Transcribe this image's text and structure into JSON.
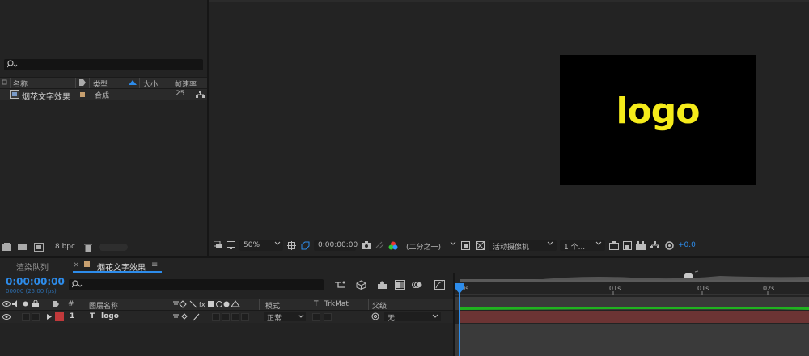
{
  "project_panel": {
    "columns": [
      "名称",
      "类型",
      "大小",
      "帧速率"
    ],
    "items": [
      {
        "name": "烟花文字效果",
        "type": "合成",
        "framerate": "25"
      }
    ],
    "bit_depth": "8 bpc"
  },
  "viewer": {
    "logo_text": "logo",
    "zoom": "50%",
    "timecode": "0:00:00:00",
    "resolution": "(二分之一)",
    "camera": "活动摄像机",
    "views": "1 个...",
    "exposure": "+0.0"
  },
  "timeline": {
    "tabs": [
      {
        "label": "渲染队列",
        "active": false
      },
      {
        "label": "烟花文字效果",
        "active": true
      }
    ],
    "tab_close": "×",
    "tab_menu": "≡",
    "current_time": "0:00:00:00",
    "fps_sub": "00000 (25.00 fps)",
    "layer_columns": {
      "number": "#",
      "name": "图层名称",
      "mode": "模式",
      "t": "T",
      "trkmat": "TrkMat",
      "parent": "父级"
    },
    "layers": [
      {
        "number": "1",
        "type_icon": "T",
        "name": "logo",
        "mode": "正常",
        "parent": "无"
      }
    ],
    "ruler_labels": [
      "00s",
      "01s",
      "01s",
      "02s"
    ]
  },
  "colors": {
    "accent": "#2d8ceb",
    "logo": "#f5eb1a",
    "layer_label": "#c0393b",
    "layer_bar": "#6c3434",
    "keyframe_green": "#1fb31f"
  }
}
